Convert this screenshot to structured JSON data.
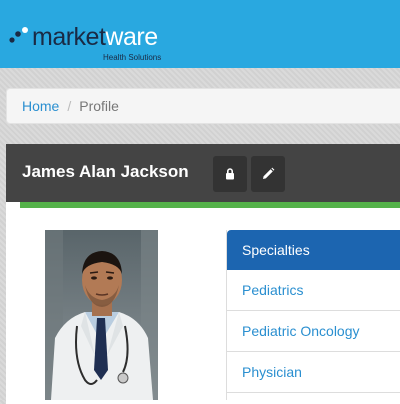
{
  "brand": {
    "name_part1": "market",
    "name_part2": "ware",
    "tagline": "Health Solutions"
  },
  "breadcrumb": {
    "home": "Home",
    "separator": "/",
    "current": "Profile"
  },
  "profile": {
    "name": "James Alan Jackson",
    "actions": [
      {
        "icon": "lock-icon"
      },
      {
        "icon": "pencil-icon"
      }
    ],
    "photo_icon": "doctor-portrait"
  },
  "specialties": {
    "header": "Specialties",
    "items": [
      "Pediatrics",
      "Pediatric Oncology",
      "Physician"
    ]
  },
  "colors": {
    "topbar": "#29a8e0",
    "panel_header": "#444444",
    "accent_green": "#55b24a",
    "list_header": "#1c65b0",
    "link": "#2a8fd0"
  }
}
